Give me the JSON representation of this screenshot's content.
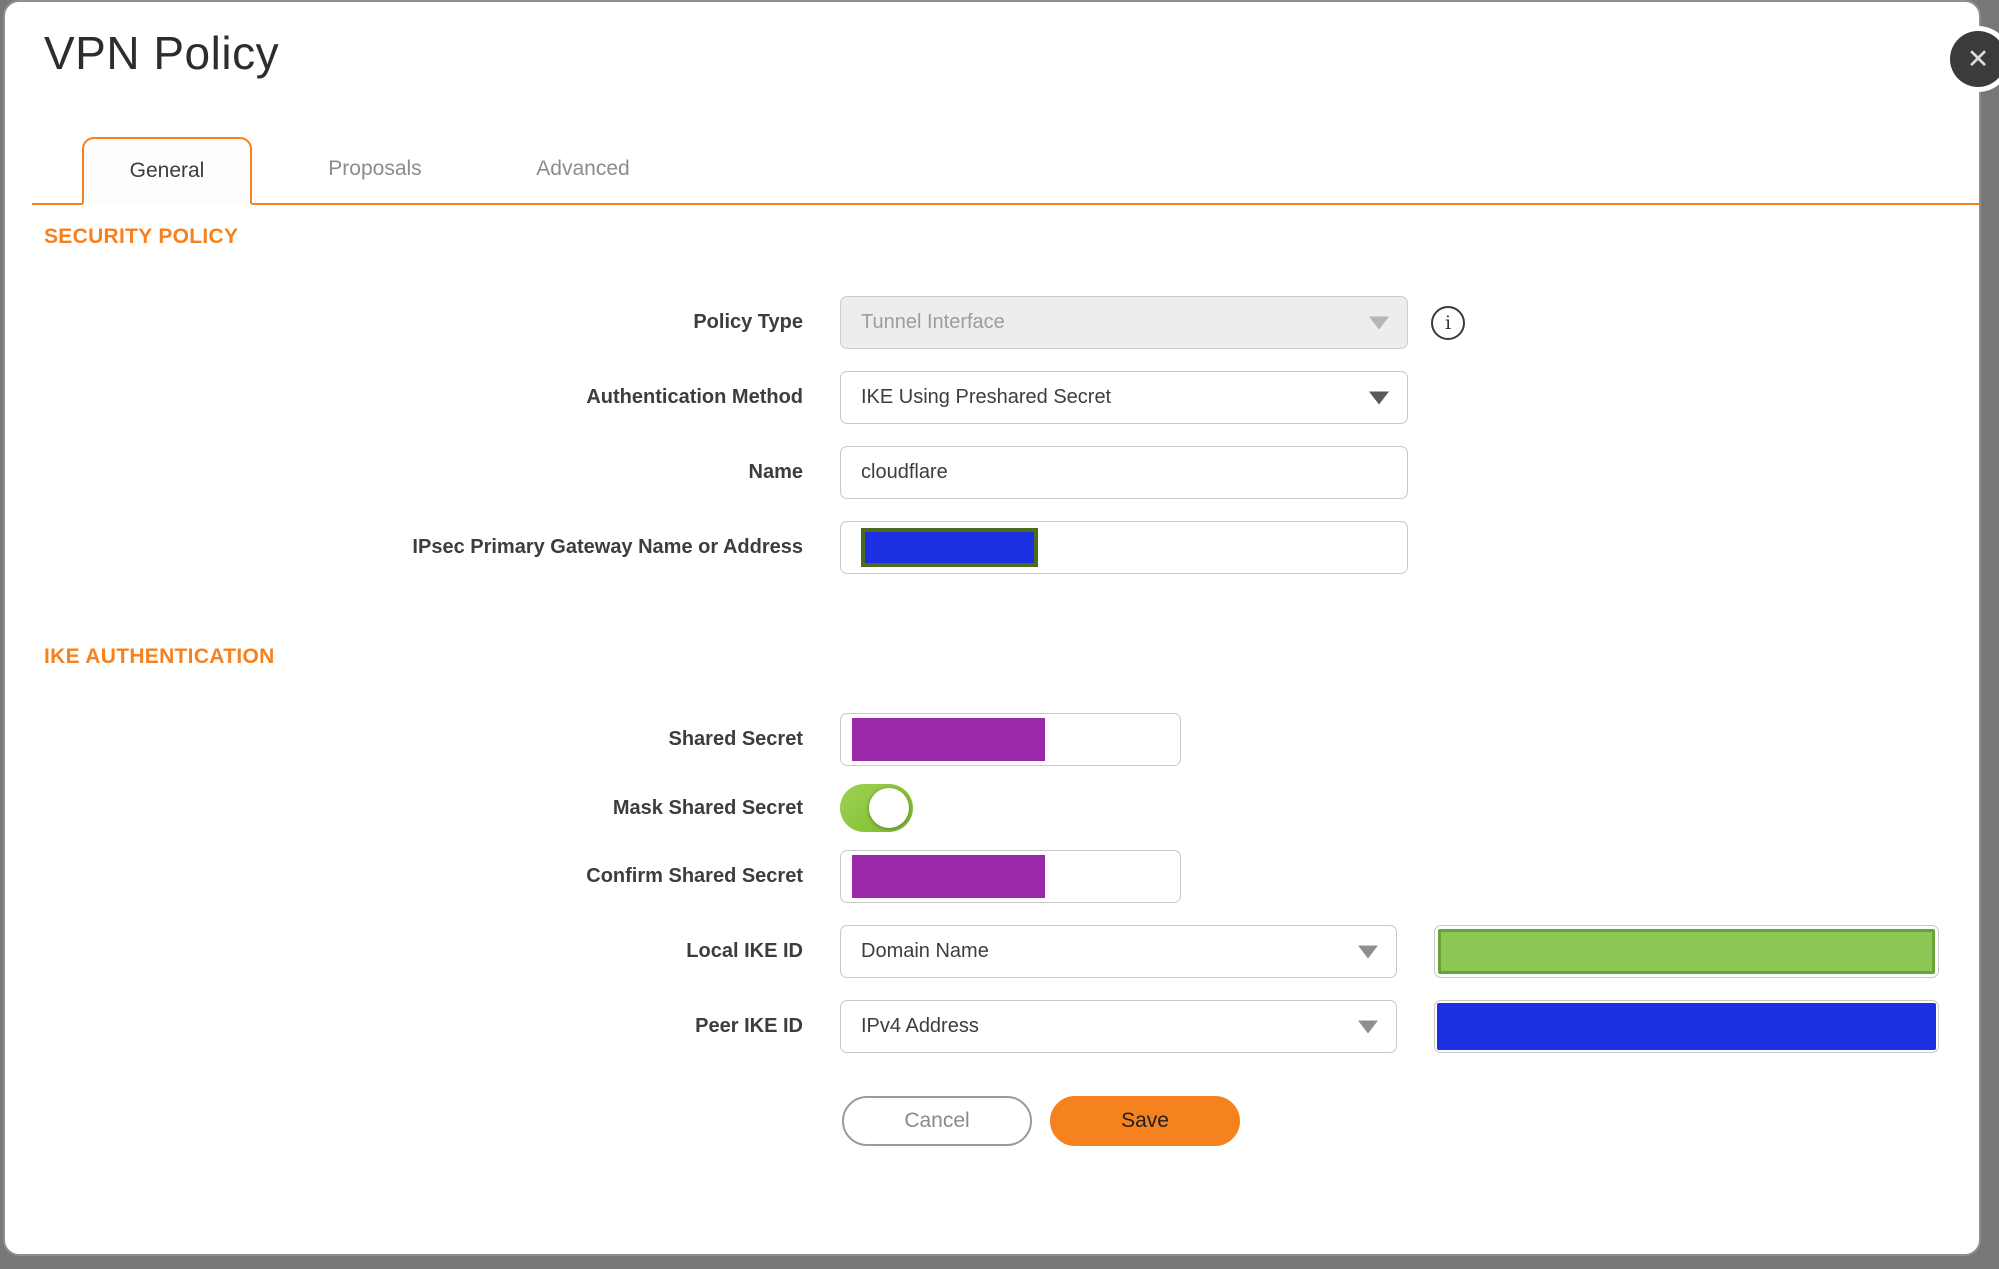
{
  "dialog": {
    "title": "VPN Policy",
    "close_icon": "✕"
  },
  "tabs": [
    {
      "label": "General",
      "active": true
    },
    {
      "label": "Proposals",
      "active": false
    },
    {
      "label": "Advanced",
      "active": false
    }
  ],
  "security_policy": {
    "heading": "SECURITY POLICY",
    "policy_type": {
      "label": "Policy Type",
      "value": "Tunnel Interface",
      "disabled": true
    },
    "authentication_method": {
      "label": "Authentication Method",
      "value": "IKE Using Preshared Secret"
    },
    "name": {
      "label": "Name",
      "value": "cloudflare"
    },
    "gateway": {
      "label": "IPsec Primary Gateway Name or Address",
      "value_redacted": true
    }
  },
  "ike_authentication": {
    "heading": "IKE AUTHENTICATION",
    "shared_secret": {
      "label": "Shared Secret",
      "value_redacted": true
    },
    "mask_shared_secret": {
      "label": "Mask Shared Secret",
      "state": "on"
    },
    "confirm_shared_secret": {
      "label": "Confirm Shared Secret",
      "value_redacted": true
    },
    "local_ike_id": {
      "label": "Local IKE ID",
      "value": "Domain Name",
      "side_value_redacted": true
    },
    "peer_ike_id": {
      "label": "Peer IKE ID",
      "value": "IPv4 Address",
      "side_value_redacted": true
    }
  },
  "footer": {
    "cancel_label": "Cancel",
    "save_label": "Save"
  },
  "colors": {
    "accent_orange": "#F5821F",
    "heading_orange": "#F6821F",
    "toggle_green": "#8DC63F",
    "redaction_blue": "#1D2FE3",
    "redaction_purple": "#9B28A8",
    "redaction_green_fill": "#8CC654",
    "redaction_green_border": "#69A238",
    "redaction_olive_border": "#4D6B1D",
    "overlay_gray": "#777777"
  }
}
